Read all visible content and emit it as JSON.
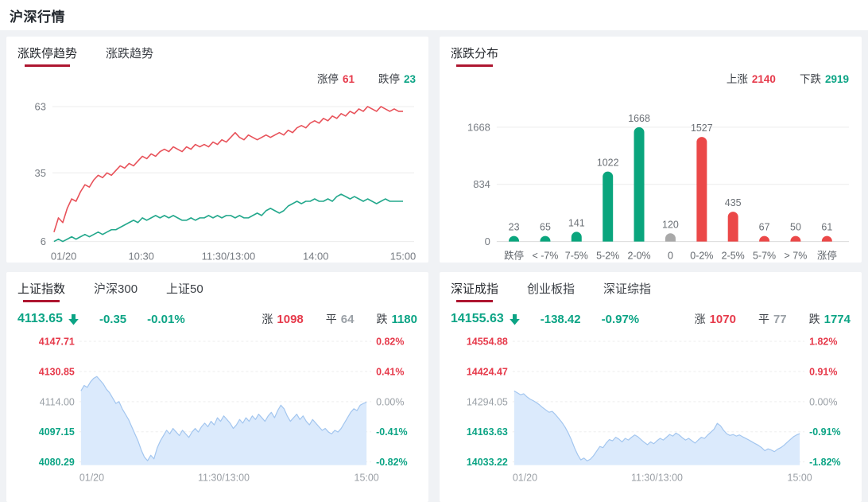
{
  "page": {
    "title": "沪深行情"
  },
  "colors": {
    "red": "#e63a4b",
    "teal": "#0ca485",
    "gray": "#9aa0a6",
    "line_red": "#e8525a",
    "line_teal": "#23a88c",
    "bar_red": "#eb4848",
    "bar_teal": "#0aa57d",
    "bar_gray": "#a9a9a9",
    "area_fill": "#dbeafc",
    "area_line": "#a3c6ef",
    "axis_text": "#767b82",
    "underline": "#ae1630"
  },
  "panels": {
    "limit_trend": {
      "tabs": [
        {
          "label": "涨跌停趋势",
          "active": true
        },
        {
          "label": "涨跌趋势",
          "active": false
        }
      ],
      "legend": [
        {
          "label": "涨停",
          "value": "61",
          "color": "red"
        },
        {
          "label": "跌停",
          "value": "23",
          "color": "teal"
        }
      ]
    },
    "distribution": {
      "tabs": [
        {
          "label": "涨跌分布",
          "active": true
        }
      ],
      "legend": [
        {
          "label": "上涨",
          "value": "2140",
          "color": "red"
        },
        {
          "label": "下跌",
          "value": "2919",
          "color": "teal"
        }
      ]
    },
    "sh_index": {
      "tabs": [
        {
          "label": "上证指数",
          "active": true
        },
        {
          "label": "沪深300",
          "active": false
        },
        {
          "label": "上证50",
          "active": false
        }
      ],
      "quote": {
        "price": "4113.65",
        "change": "-0.35",
        "pct": "-0.01%",
        "direction": "down"
      },
      "counts": [
        {
          "label": "涨",
          "value": "1098",
          "color": "red"
        },
        {
          "label": "平",
          "value": "64",
          "color": "gray"
        },
        {
          "label": "跌",
          "value": "1180",
          "color": "teal"
        }
      ]
    },
    "sz_index": {
      "tabs": [
        {
          "label": "深证成指",
          "active": true
        },
        {
          "label": "创业板指",
          "active": false
        },
        {
          "label": "深证综指",
          "active": false
        }
      ],
      "quote": {
        "price": "14155.63",
        "change": "-138.42",
        "pct": "-0.97%",
        "direction": "down"
      },
      "counts": [
        {
          "label": "涨",
          "value": "1070",
          "color": "red"
        },
        {
          "label": "平",
          "value": "77",
          "color": "gray"
        },
        {
          "label": "跌",
          "value": "1774",
          "color": "teal"
        }
      ]
    }
  },
  "chart_data": [
    {
      "id": "limit_trend",
      "type": "line",
      "title": "涨跌停趋势",
      "x_ticks": [
        "01/20",
        "10:30",
        "11:30/13:00",
        "14:00",
        "15:00"
      ],
      "y_ticks": [
        63,
        35,
        6
      ],
      "ylim": [
        6,
        63
      ],
      "grid": true,
      "series": [
        {
          "name": "涨停",
          "color": "line_red",
          "end_value": 61,
          "values": [
            10,
            16,
            14,
            20,
            24,
            23,
            27,
            30,
            29,
            32,
            34,
            33,
            35,
            34,
            36,
            38,
            37,
            39,
            38,
            40,
            42,
            41,
            43,
            42,
            44,
            45,
            44,
            46,
            45,
            44,
            46,
            45,
            47,
            46,
            47,
            46,
            48,
            47,
            49,
            48,
            50,
            52,
            50,
            49,
            51,
            50,
            49,
            50,
            51,
            50,
            51,
            52,
            51,
            53,
            52,
            54,
            55,
            54,
            56,
            57,
            56,
            58,
            57,
            59,
            58,
            60,
            59,
            61,
            60,
            62,
            61,
            63,
            62,
            61,
            63,
            62,
            61,
            62,
            61,
            61
          ]
        },
        {
          "name": "跌停",
          "color": "line_teal",
          "end_value": 23,
          "values": [
            6,
            7,
            6,
            7,
            8,
            7,
            8,
            9,
            8,
            9,
            10,
            9,
            10,
            11,
            11,
            12,
            13,
            14,
            15,
            14,
            16,
            15,
            16,
            17,
            16,
            17,
            16,
            17,
            16,
            15,
            15,
            16,
            15,
            16,
            16,
            17,
            16,
            17,
            16,
            17,
            17,
            16,
            17,
            16,
            16,
            17,
            18,
            17,
            19,
            20,
            19,
            18,
            19,
            21,
            22,
            23,
            22,
            23,
            23,
            24,
            23,
            23,
            24,
            23,
            25,
            26,
            25,
            24,
            25,
            24,
            23,
            24,
            23,
            22,
            23,
            24,
            23,
            23,
            23,
            23
          ]
        }
      ]
    },
    {
      "id": "distribution",
      "type": "bar",
      "title": "涨跌分布",
      "categories": [
        "跌停",
        "< -7%",
        "7-5%",
        "5-2%",
        "2-0%",
        "0",
        "0-2%",
        "2-5%",
        "5-7%",
        "> 7%",
        "涨停"
      ],
      "values": [
        23,
        65,
        141,
        1022,
        1668,
        120,
        1527,
        435,
        67,
        50,
        61
      ],
      "bar_colors": [
        "bar_teal",
        "bar_teal",
        "bar_teal",
        "bar_teal",
        "bar_teal",
        "bar_gray",
        "bar_red",
        "bar_red",
        "bar_red",
        "bar_red",
        "bar_red"
      ],
      "y_ticks": [
        1668,
        834,
        0
      ],
      "ylim": [
        0,
        1668
      ],
      "grid": true
    },
    {
      "id": "sh_index",
      "type": "area",
      "title": "上证指数分时",
      "x_ticks": [
        "01/20",
        "11:30/13:00",
        "15:00"
      ],
      "left_labels": [
        "4147.71",
        "4130.85",
        "4114.00",
        "4097.15",
        "4080.29"
      ],
      "right_labels": [
        "0.82%",
        "0.41%",
        "0.00%",
        "-0.41%",
        "-0.82%"
      ],
      "label_colors": [
        "red",
        "red",
        "gray",
        "teal",
        "teal"
      ],
      "ylim": [
        4080.29,
        4147.71
      ],
      "prev_close": 4114.0,
      "values": [
        4120,
        4123,
        4122,
        4125,
        4127,
        4128,
        4126,
        4124,
        4121,
        4119,
        4116,
        4113,
        4114,
        4110,
        4107,
        4104,
        4100,
        4096,
        4092,
        4087,
        4083,
        4081,
        4084,
        4082,
        4088,
        4092,
        4095,
        4098,
        4096,
        4099,
        4097,
        4095,
        4098,
        4096,
        4094,
        4097,
        4099,
        4097,
        4100,
        4102,
        4100,
        4103,
        4101,
        4105,
        4103,
        4106,
        4104,
        4102,
        4099,
        4101,
        4104,
        4102,
        4105,
        4103,
        4106,
        4104,
        4107,
        4105,
        4103,
        4106,
        4108,
        4105,
        4109,
        4112,
        4110,
        4106,
        4103,
        4105,
        4107,
        4104,
        4106,
        4103,
        4101,
        4104,
        4102,
        4100,
        4098,
        4099,
        4097,
        4096,
        4098,
        4097,
        4099,
        4102,
        4105,
        4108,
        4110,
        4109,
        4112,
        4113,
        4113.65
      ]
    },
    {
      "id": "sz_index",
      "type": "area",
      "title": "深证成指分时",
      "x_ticks": [
        "01/20",
        "11:30/13:00",
        "15:00"
      ],
      "left_labels": [
        "14554.88",
        "14424.47",
        "14294.05",
        "14163.63",
        "14033.22"
      ],
      "right_labels": [
        "1.82%",
        "0.91%",
        "0.00%",
        "-0.91%",
        "-1.82%"
      ],
      "label_colors": [
        "red",
        "red",
        "gray",
        "teal",
        "teal"
      ],
      "ylim": [
        14033.22,
        14554.88
      ],
      "prev_close": 14294.05,
      "values": [
        14340,
        14332,
        14324,
        14328,
        14315,
        14305,
        14298,
        14290,
        14280,
        14268,
        14258,
        14248,
        14252,
        14238,
        14222,
        14205,
        14185,
        14160,
        14130,
        14095,
        14065,
        14042,
        14050,
        14038,
        14045,
        14060,
        14080,
        14100,
        14095,
        14115,
        14130,
        14125,
        14140,
        14132,
        14120,
        14135,
        14128,
        14140,
        14150,
        14142,
        14130,
        14118,
        14108,
        14120,
        14112,
        14125,
        14135,
        14128,
        14140,
        14152,
        14145,
        14158,
        14150,
        14138,
        14128,
        14135,
        14125,
        14115,
        14128,
        14140,
        14135,
        14150,
        14162,
        14175,
        14200,
        14190,
        14170,
        14155,
        14148,
        14152,
        14145,
        14150,
        14142,
        14135,
        14128,
        14120,
        14112,
        14105,
        14095,
        14082,
        14090,
        14085,
        14078,
        14088,
        14095,
        14105,
        14118,
        14130,
        14142,
        14150,
        14155.63
      ]
    }
  ]
}
